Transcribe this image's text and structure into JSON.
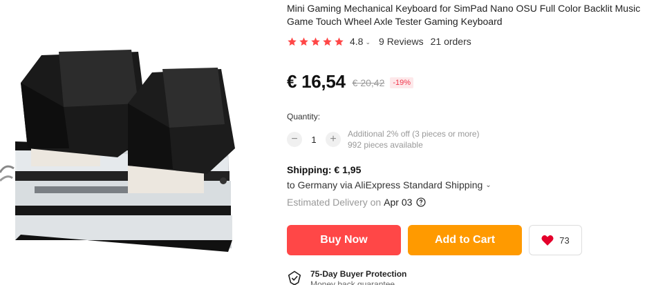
{
  "product": {
    "title": "Mini Gaming Mechanical Keyboard for SimPad Nano OSU Full Color Backlit Music Game Touch Wheel Axle Tester Gaming Keyboard",
    "rating": "4.8",
    "reviews": "9 Reviews",
    "orders": "21 orders",
    "image_icon": "keyboard-product-image"
  },
  "price": {
    "current": "€ 16,54",
    "original": "€ 20,42",
    "discount": "-19%"
  },
  "quantity": {
    "label": "Quantity:",
    "value": "1",
    "minus": "−",
    "plus": "+",
    "note_discount": "Additional 2% off (3 pieces or more)",
    "note_available": "992 pieces available"
  },
  "shipping": {
    "title": "Shipping: € 1,95",
    "destination": "to Germany via AliExpress Standard Shipping",
    "delivery_label": "Estimated Delivery on",
    "delivery_date": "Apr 03"
  },
  "actions": {
    "buy_now": "Buy Now",
    "add_to_cart": "Add to Cart",
    "wishlist_count": "73"
  },
  "protection": {
    "title": "75-Day Buyer Protection",
    "subtitle": "Money back guarantee"
  },
  "colors": {
    "buy": "#ff4747",
    "cart": "#ff9a00",
    "star": "#ff4747",
    "discount": "#f0354a"
  }
}
